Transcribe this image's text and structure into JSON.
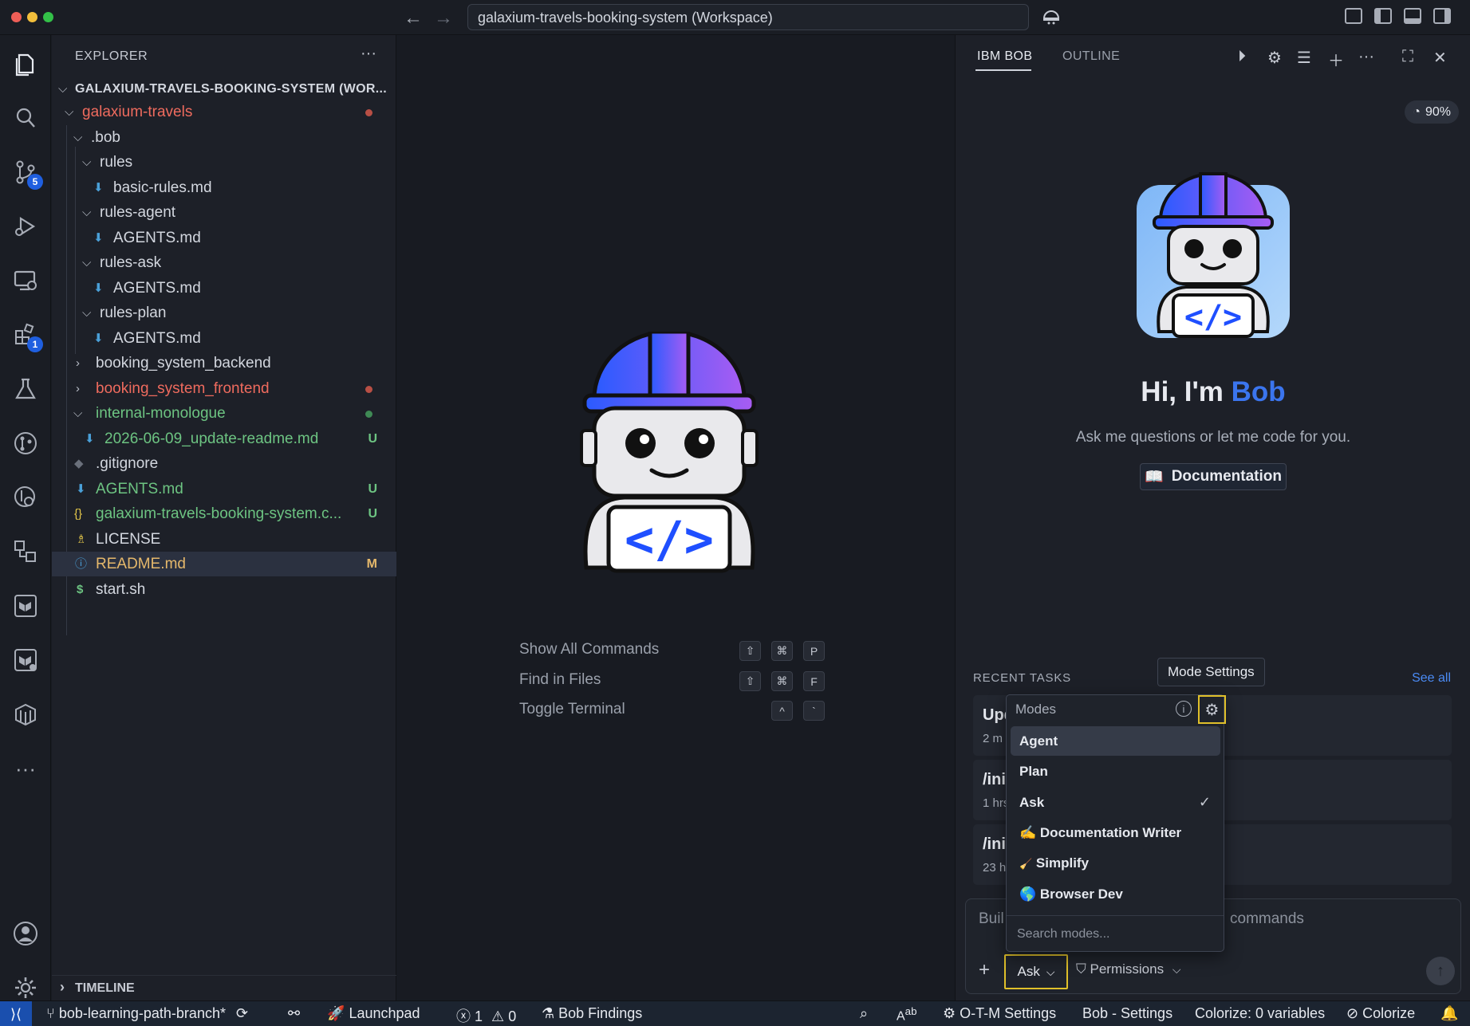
{
  "window": {
    "command_center": "galaxium-travels-booking-system (Workspace)"
  },
  "activity_bar": {
    "source_control_badge": "5",
    "extensions_badge": "1"
  },
  "explorer": {
    "title": "EXPLORER",
    "workspace_root": "GALAXIUM-TRAVELS-BOOKING-SYSTEM (WOR...",
    "items": [
      {
        "label": "galaxium-travels",
        "status": ""
      },
      {
        "label": ".bob",
        "status": ""
      },
      {
        "label": "rules",
        "status": ""
      },
      {
        "label": "basic-rules.md",
        "status": ""
      },
      {
        "label": "rules-agent",
        "status": ""
      },
      {
        "label": "AGENTS.md",
        "status": ""
      },
      {
        "label": "rules-ask",
        "status": ""
      },
      {
        "label": "AGENTS.md",
        "status": ""
      },
      {
        "label": "rules-plan",
        "status": ""
      },
      {
        "label": "AGENTS.md",
        "status": ""
      },
      {
        "label": "booking_system_backend",
        "status": ""
      },
      {
        "label": "booking_system_frontend",
        "status": ""
      },
      {
        "label": "internal-monologue",
        "status": ""
      },
      {
        "label": "2026-06-09_update-readme.md",
        "status": "U"
      },
      {
        "label": ".gitignore",
        "status": ""
      },
      {
        "label": "AGENTS.md",
        "status": "U"
      },
      {
        "label": "galaxium-travels-booking-system.c...",
        "status": "U"
      },
      {
        "label": "LICENSE",
        "status": ""
      },
      {
        "label": "README.md",
        "status": "M"
      },
      {
        "label": "start.sh",
        "status": ""
      }
    ],
    "timeline": "TIMELINE"
  },
  "editor": {
    "shortcuts": [
      {
        "label": "Show All Commands",
        "keys": [
          "⇧",
          "⌘",
          "P"
        ]
      },
      {
        "label": "Find in Files",
        "keys": [
          "⇧",
          "⌘",
          "F"
        ]
      },
      {
        "label": "Toggle Terminal",
        "keys": [
          "^",
          "`"
        ]
      }
    ]
  },
  "panel": {
    "tabs": [
      "IBM BOB",
      "OUTLINE"
    ],
    "usage": "90%",
    "greeting_prefix": "Hi, I'm ",
    "greeting_name": "Bob",
    "subtitle": "Ask me questions or let me code for you.",
    "documentation_button": "Documentation",
    "recent_tasks_title": "RECENT TASKS",
    "see_all": "See all",
    "tasks": [
      {
        "title": "Upd",
        "time": "2 m"
      },
      {
        "title": "/init",
        "time": "1 hrs"
      },
      {
        "title": "/init",
        "time": "23 h"
      }
    ],
    "input": {
      "placeholder_left": "Buil",
      "placeholder_right": "commands",
      "mode": "Ask",
      "permissions": "Permissions"
    }
  },
  "tooltip": "Mode Settings",
  "modes_popup": {
    "label": "Modes",
    "items": [
      {
        "label": "Agent",
        "emoji": ""
      },
      {
        "label": "Plan",
        "emoji": ""
      },
      {
        "label": "Ask",
        "emoji": ""
      },
      {
        "label": "Documentation Writer",
        "emoji": "✍️"
      },
      {
        "label": "Simplify",
        "emoji": "🧹"
      },
      {
        "label": "Browser Dev",
        "emoji": "🌎"
      }
    ],
    "selected": "Ask",
    "search_placeholder": "Search modes..."
  },
  "statusbar": {
    "branch": "bob-learning-path-branch*",
    "launchpad": "Launchpad",
    "errors": "1",
    "warnings": "0",
    "bob_findings": "Bob Findings",
    "otm_settings": "O-T-M Settings",
    "bob_settings": "Bob - Settings",
    "colorize_vars": "Colorize: 0 variables",
    "colorize": "Colorize"
  }
}
